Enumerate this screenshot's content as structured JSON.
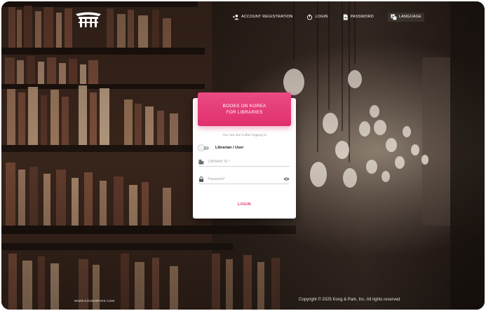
{
  "nav": {
    "account_registration": "ACCOUNT REGISTRATION",
    "login": "LOGIN",
    "password": "PASSWORD",
    "language": "LANGUAGE"
  },
  "card": {
    "title_line1": "BOOKS ON KOREA",
    "title_line2": "FOR LIBRARIES",
    "subtitle": "You can use it after logging in",
    "toggle_label": "Librarian / User",
    "library_id_placeholder": "LIBRARY ID *",
    "password_placeholder": "Password*",
    "login_button": "LOGIN"
  },
  "footer": {
    "website": "WWW.KONGNPARK.COM",
    "copyright": "Copyright © 2025 Kong & Park, Inc. All rights reserved"
  },
  "colors": {
    "accent": "#e0306d",
    "accent_light": "#ea4b83"
  },
  "icons": {
    "logo": "korean-gate-logo",
    "account_registration": "person-add-icon",
    "login": "power-icon",
    "password": "document-icon",
    "language": "translate-icon"
  }
}
